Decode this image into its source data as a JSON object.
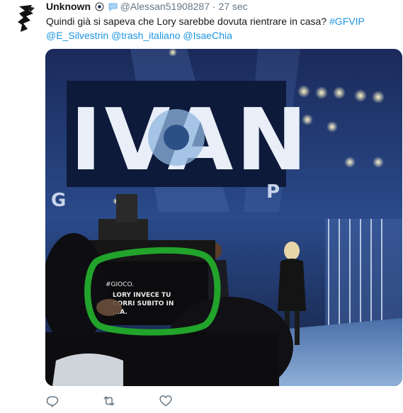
{
  "tweet": {
    "author_name": "Unknown",
    "handle": "@Alessan51908287",
    "separator": "·",
    "time": "27 sec",
    "text": "Quindi già si sapeva che Lory sarebbe dovuta rientrare in casa?",
    "hashtag": "#GFVIP",
    "mentions": [
      "@E_Silvestrin",
      "@trash_italiano",
      "@IsaeChia"
    ]
  },
  "media": {
    "stage_sign": "IVAN",
    "stage_sign_sub": "G",
    "stage_sign_sub2": "P",
    "screen_text_1": "#GIOCO.",
    "screen_text_2": "LORY INVECE TU",
    "screen_text_3": "CORRI SUBITO IN",
    "screen_text_4": "...A.",
    "highlight_color": "#22a32b"
  },
  "actions": {
    "reply_icon": "reply-icon",
    "retweet_icon": "retweet-icon",
    "like_icon": "heart-icon"
  },
  "colors": {
    "link": "#1b95e0",
    "meta": "#657786",
    "icon": "#657786"
  }
}
